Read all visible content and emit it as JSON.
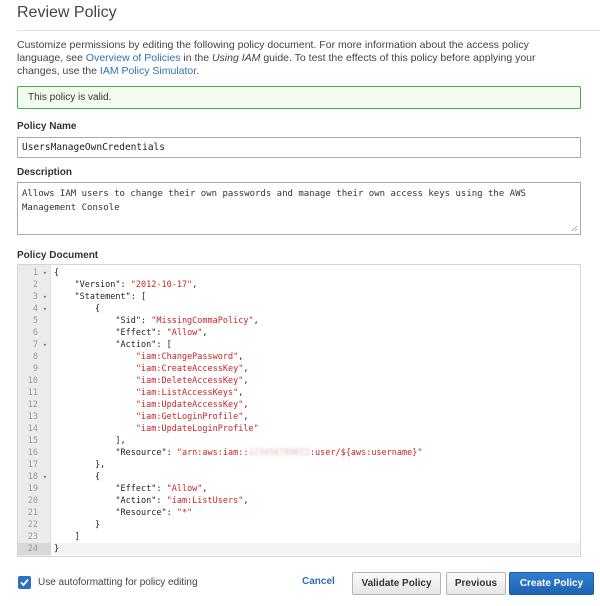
{
  "page": {
    "title": "Review Policy",
    "intro": {
      "text_1": "Customize permissions by editing the following policy document. For more information about the access policy language, see ",
      "link_1": "Overview of Policies",
      "text_2": " in the ",
      "italic": "Using IAM",
      "text_3": " guide. To test the effects of this policy before applying your changes, use the ",
      "link_2": "IAM Policy Simulator",
      "text_4": "."
    },
    "validation_message": "This policy is valid."
  },
  "form": {
    "policy_name_label": "Policy Name",
    "policy_name_value": "UsersManageOwnCredentials",
    "description_label": "Description",
    "description_value": "Allows IAM users to change their own passwords and manage their own access keys using the AWS Management Console",
    "document_label": "Policy Document"
  },
  "editor": {
    "lines": [
      {
        "n": "1",
        "fold": true,
        "tokens": [
          {
            "t": "{"
          }
        ]
      },
      {
        "n": "2",
        "tokens": [
          {
            "t": "    \"Version\": "
          },
          {
            "t": "\"2012-10-17\"",
            "c": "str"
          },
          {
            "t": ","
          }
        ]
      },
      {
        "n": "3",
        "fold": true,
        "tokens": [
          {
            "t": "    \"Statement\": ["
          }
        ]
      },
      {
        "n": "4",
        "fold": true,
        "tokens": [
          {
            "t": "        {"
          }
        ]
      },
      {
        "n": "5",
        "tokens": [
          {
            "t": "            \"Sid\": "
          },
          {
            "t": "\"MissingCommaPolicy\"",
            "c": "str"
          },
          {
            "t": ","
          }
        ]
      },
      {
        "n": "6",
        "tokens": [
          {
            "t": "            \"Effect\": "
          },
          {
            "t": "\"Allow\"",
            "c": "str"
          },
          {
            "t": ","
          }
        ]
      },
      {
        "n": "7",
        "fold": true,
        "tokens": [
          {
            "t": "            \"Action\": ["
          }
        ]
      },
      {
        "n": "8",
        "tokens": [
          {
            "t": "                "
          },
          {
            "t": "\"iam:ChangePassword\"",
            "c": "str"
          },
          {
            "t": ","
          }
        ]
      },
      {
        "n": "9",
        "tokens": [
          {
            "t": "                "
          },
          {
            "t": "\"iam:CreateAccessKey\"",
            "c": "str"
          },
          {
            "t": ","
          }
        ]
      },
      {
        "n": "10",
        "tokens": [
          {
            "t": "                "
          },
          {
            "t": "\"iam:DeleteAccessKey\"",
            "c": "str"
          },
          {
            "t": ","
          }
        ]
      },
      {
        "n": "11",
        "tokens": [
          {
            "t": "                "
          },
          {
            "t": "\"iam:ListAccessKeys\"",
            "c": "str"
          },
          {
            "t": ","
          }
        ]
      },
      {
        "n": "12",
        "tokens": [
          {
            "t": "                "
          },
          {
            "t": "\"iam:UpdateAccessKey\"",
            "c": "str"
          },
          {
            "t": ","
          }
        ]
      },
      {
        "n": "13",
        "tokens": [
          {
            "t": "                "
          },
          {
            "t": "\"iam:GetLoginProfile\"",
            "c": "str"
          },
          {
            "t": ","
          }
        ]
      },
      {
        "n": "14",
        "tokens": [
          {
            "t": "                "
          },
          {
            "t": "\"iam:UpdateLoginProfile\"",
            "c": "str"
          }
        ]
      },
      {
        "n": "15",
        "tokens": [
          {
            "t": "            ],"
          }
        ]
      },
      {
        "n": "16",
        "tokens": [
          {
            "t": "            \"Resource\": "
          },
          {
            "t": "\"arn:aws:iam::",
            "c": "str"
          },
          {
            "t": "123456789012",
            "c": "blurred"
          },
          {
            "t": ":user/${aws:username}\"",
            "c": "str"
          }
        ]
      },
      {
        "n": "17",
        "tokens": [
          {
            "t": "        },"
          }
        ]
      },
      {
        "n": "18",
        "fold": true,
        "tokens": [
          {
            "t": "        {"
          }
        ]
      },
      {
        "n": "19",
        "tokens": [
          {
            "t": "            \"Effect\": "
          },
          {
            "t": "\"Allow\"",
            "c": "str"
          },
          {
            "t": ","
          }
        ]
      },
      {
        "n": "20",
        "tokens": [
          {
            "t": "            \"Action\": "
          },
          {
            "t": "\"iam:ListUsers\"",
            "c": "str"
          },
          {
            "t": ","
          }
        ]
      },
      {
        "n": "21",
        "tokens": [
          {
            "t": "            \"Resource\": "
          },
          {
            "t": "\"*\"",
            "c": "str"
          }
        ]
      },
      {
        "n": "22",
        "tokens": [
          {
            "t": "        }"
          }
        ]
      },
      {
        "n": "23",
        "tokens": [
          {
            "t": "    ]"
          }
        ]
      },
      {
        "n": "24",
        "active": true,
        "tokens": [
          {
            "t": "}"
          }
        ]
      }
    ]
  },
  "footer": {
    "autoformat_label": "Use autoformatting for policy editing",
    "autoformat_checked": true,
    "cancel_label": "Cancel",
    "validate_label": "Validate Policy",
    "previous_label": "Previous",
    "create_label": "Create Policy"
  },
  "colors": {
    "accent": "#2f6fb5",
    "primary_button": "#1f64b2",
    "valid_border": "#4cae4c",
    "string_token": "#c92424"
  }
}
